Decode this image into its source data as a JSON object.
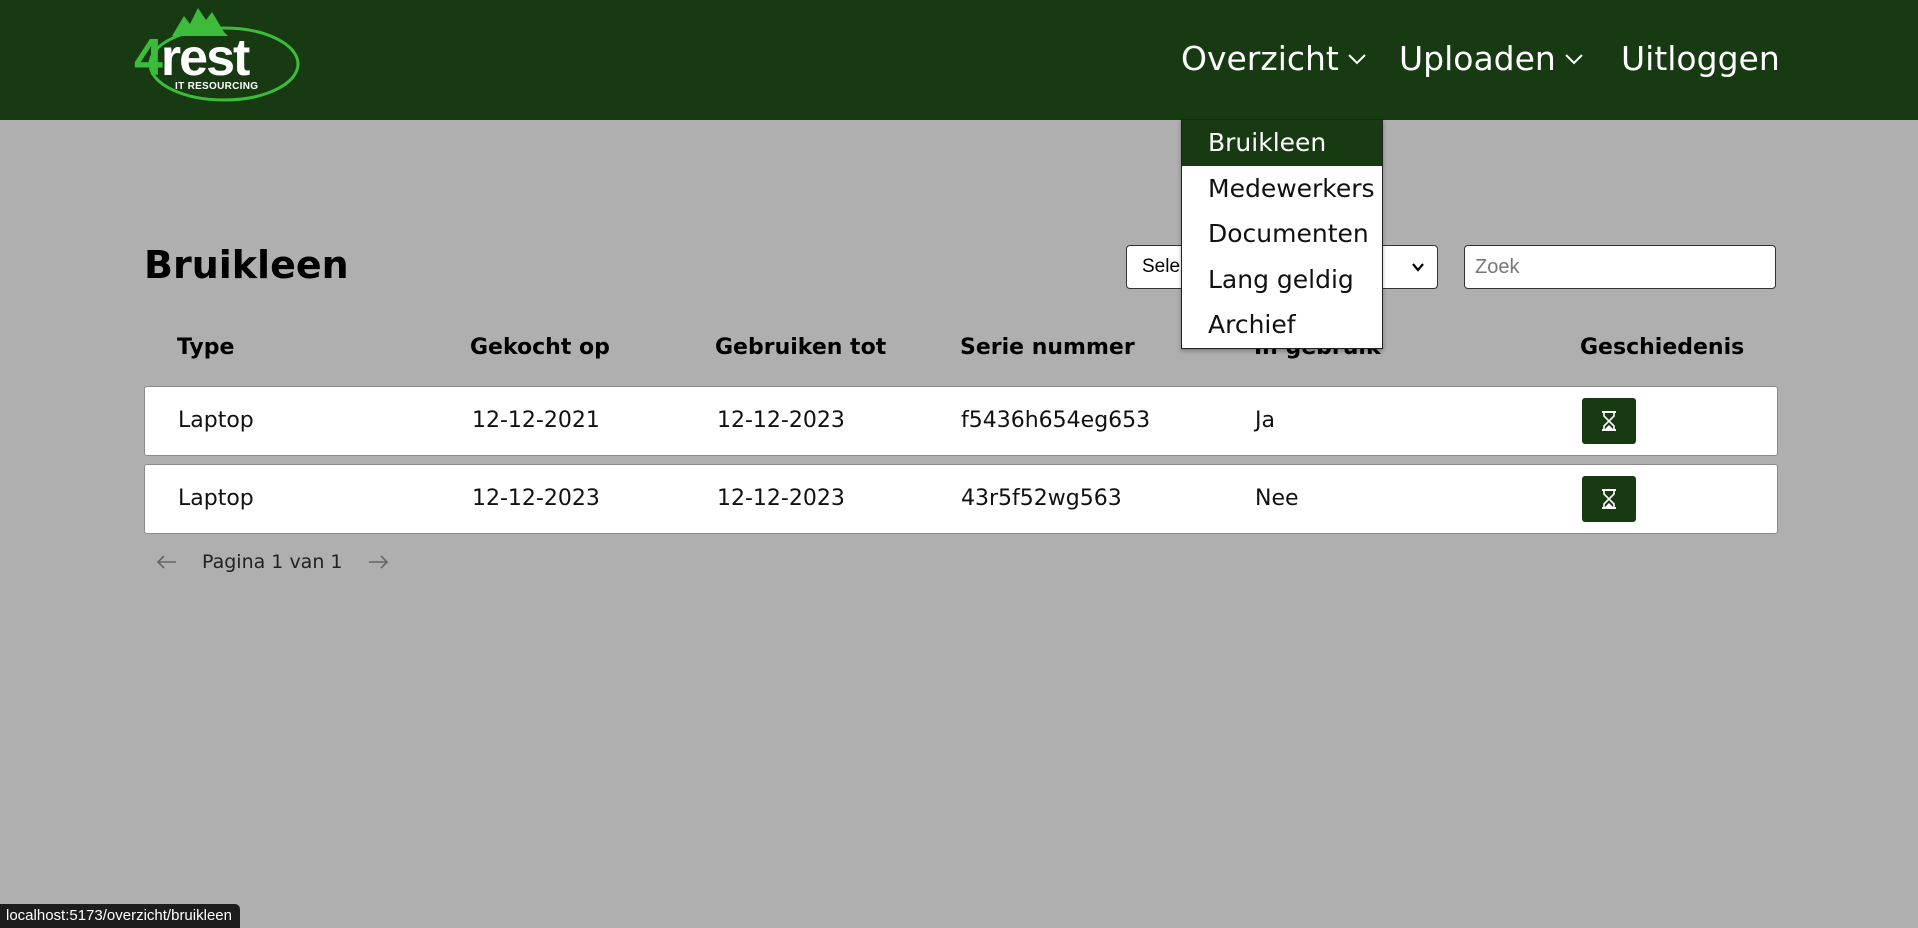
{
  "logo": {
    "mark": "4",
    "word": "rest",
    "subtitle": "IT RESOURCING"
  },
  "nav": {
    "overzicht": "Overzicht",
    "uploaden": "Uploaden",
    "uitloggen": "Uitloggen"
  },
  "dropdown": {
    "items": [
      "Bruikleen",
      "Medewerkers",
      "Documenten",
      "Lang geldig",
      "Archief"
    ],
    "active": "Bruikleen"
  },
  "page": {
    "title": "Bruikleen",
    "select_value": "Sele",
    "search_placeholder": "Zoek",
    "search_value": ""
  },
  "table": {
    "headers": {
      "type": "Type",
      "bought": "Gekocht op",
      "use_until": "Gebruiken tot",
      "serial": "Serie nummer",
      "in_use": "In gebruik",
      "history": "Geschiedenis"
    },
    "rows": [
      {
        "type": "Laptop",
        "bought": "12-12-2021",
        "use_until": "12-12-2023",
        "serial": "f5436h654eg653",
        "in_use": "Ja"
      },
      {
        "type": "Laptop",
        "bought": "12-12-2023",
        "use_until": "12-12-2023",
        "serial": "43r5f52wg563",
        "in_use": "Nee"
      }
    ],
    "history_icon": "hourglass-icon"
  },
  "pagination": {
    "text": "Pagina 1 van 1"
  },
  "status_url": "localhost:5173/overzicht/bruikleen",
  "colors": {
    "brand_dark_green": "#173a13",
    "logo_green": "#3dbb3a",
    "background": "#afafaf"
  }
}
